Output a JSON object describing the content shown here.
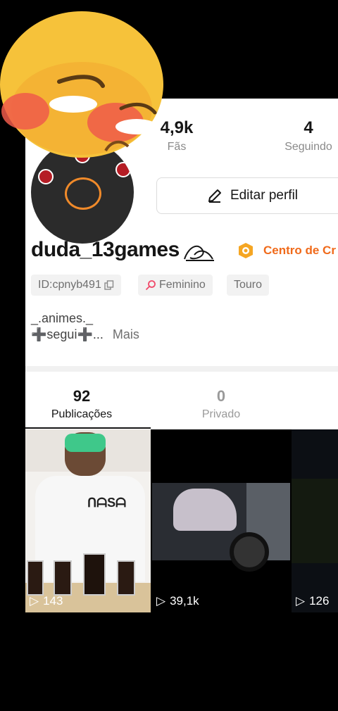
{
  "stats": [
    {
      "value": "4,9k",
      "label": "Fãs"
    },
    {
      "value": "4",
      "label": "Seguindo"
    }
  ],
  "edit_button_label": "Editar perfil",
  "username": "duda_13games",
  "creator_center_label": "Centro de Cr",
  "tags": [
    "ID:cpnyb491",
    "Feminino",
    "Touro"
  ],
  "bio": {
    "line1": "_.animes._",
    "line2": "➕segui➕...",
    "more_label": "Mais"
  },
  "tabs": [
    {
      "count": "92",
      "label": "Publicações",
      "active": true
    },
    {
      "count": "0",
      "label": "Privado",
      "active": false
    }
  ],
  "videos": [
    {
      "views": "143"
    },
    {
      "views": "39,1k"
    },
    {
      "views": "126"
    }
  ],
  "colors": {
    "accent": "#f06a1a",
    "text": "#161616",
    "muted": "#8a8a8a"
  }
}
